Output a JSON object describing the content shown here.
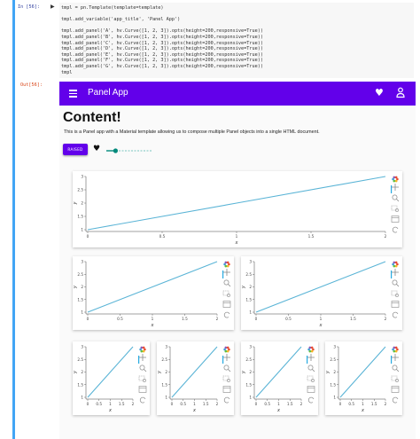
{
  "notebook": {
    "in_prompt": "In [56]:",
    "out_prompt": "Out[56]:",
    "code_lines": [
      "tmpl = pn.Template(template=template)",
      "",
      "tmpl.add_variable('app_title', 'Panel App')",
      "",
      "tmpl.add_panel('A', hv.Curve([1, 2, 3]).opts(height=200,responsive=True))",
      "tmpl.add_panel('B', hv.Curve([1, 2, 3]).opts(height=200,responsive=True))",
      "tmpl.add_panel('C', hv.Curve([1, 2, 3]).opts(height=200,responsive=True))",
      "tmpl.add_panel('D', hv.Curve([1, 2, 3]).opts(height=200,responsive=True))",
      "tmpl.add_panel('E', hv.Curve([1, 2, 3]).opts(height=200,responsive=True))",
      "tmpl.add_panel('F', hv.Curve([1, 2, 3]).opts(height=200,responsive=True))",
      "tmpl.add_panel('G', hv.Curve([1, 2, 3]).opts(height=200,responsive=True))",
      "tmpl"
    ]
  },
  "app": {
    "title": "Panel App",
    "heading": "Content!",
    "intro": "This is a Panel app with a Material template allowing us to compose multiple Panel objects into a single HTML document.",
    "button_label": "RAISED",
    "slider_value": 0.2,
    "colors": {
      "primary": "#6200ea",
      "curve": "#5ab4d6"
    }
  },
  "chart_data": [
    {
      "type": "line",
      "x": [
        0,
        1,
        2
      ],
      "y": [
        1,
        2,
        3
      ],
      "xlabel": "x",
      "ylabel": "y",
      "xticks": [
        "0",
        "0.5",
        "1",
        "1.5",
        "2"
      ],
      "yticks": [
        "1",
        "1.5",
        "2",
        "2.5",
        "3"
      ]
    },
    {
      "type": "line",
      "x": [
        0,
        1,
        2
      ],
      "y": [
        1,
        2,
        3
      ],
      "xlabel": "x",
      "ylabel": "y",
      "xticks": [
        "0",
        "0.5",
        "1",
        "1.5",
        "2"
      ],
      "yticks": [
        "1",
        "1.5",
        "2",
        "2.5",
        "3"
      ]
    },
    {
      "type": "line",
      "x": [
        0,
        1,
        2
      ],
      "y": [
        1,
        2,
        3
      ],
      "xlabel": "x",
      "ylabel": "y",
      "xticks": [
        "0",
        "0.5",
        "1",
        "1.5",
        "2"
      ],
      "yticks": [
        "1",
        "1.5",
        "2",
        "2.5",
        "3"
      ]
    },
    {
      "type": "line",
      "x": [
        0,
        1,
        2
      ],
      "y": [
        1,
        2,
        3
      ],
      "xlabel": "x",
      "ylabel": "y",
      "xticks": [
        "0",
        "0.5",
        "1",
        "1.5",
        "2"
      ],
      "yticks": [
        "1",
        "1.5",
        "2",
        "2.5",
        "3"
      ]
    },
    {
      "type": "line",
      "x": [
        0,
        1,
        2
      ],
      "y": [
        1,
        2,
        3
      ],
      "xlabel": "x",
      "ylabel": "y",
      "xticks": [
        "0",
        "0.5",
        "1",
        "1.5",
        "2"
      ],
      "yticks": [
        "1",
        "1.5",
        "2",
        "2.5",
        "3"
      ]
    },
    {
      "type": "line",
      "x": [
        0,
        1,
        2
      ],
      "y": [
        1,
        2,
        3
      ],
      "xlabel": "x",
      "ylabel": "y",
      "xticks": [
        "0",
        "0.5",
        "1",
        "1.5",
        "2"
      ],
      "yticks": [
        "1",
        "1.5",
        "2",
        "2.5",
        "3"
      ]
    },
    {
      "type": "line",
      "x": [
        0,
        1,
        2
      ],
      "y": [
        1,
        2,
        3
      ],
      "xlabel": "x",
      "ylabel": "y",
      "xticks": [
        "0",
        "0.5",
        "1",
        "1.5",
        "2"
      ],
      "yticks": [
        "1",
        "1.5",
        "2",
        "2.5",
        "3"
      ]
    }
  ]
}
